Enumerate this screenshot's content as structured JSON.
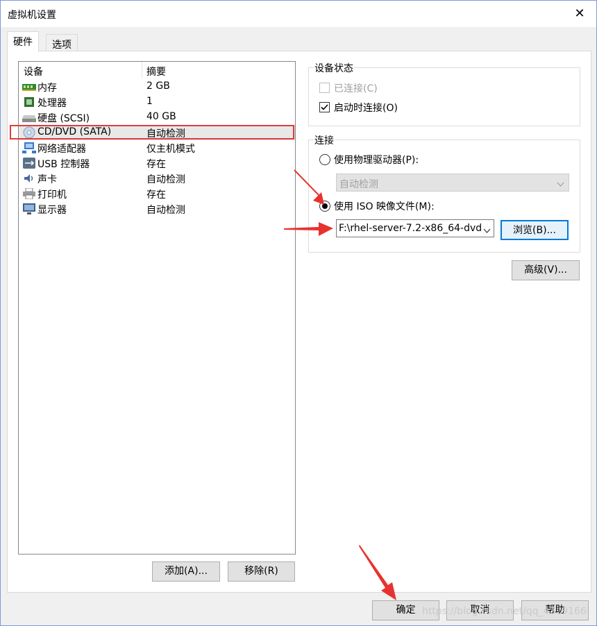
{
  "window": {
    "title": "虚拟机设置",
    "close_glyph": "✕"
  },
  "tabs": [
    {
      "label": "硬件",
      "active": true
    },
    {
      "label": "选项",
      "active": false
    }
  ],
  "device_list": {
    "columns": [
      "设备",
      "摘要"
    ],
    "rows": [
      {
        "name": "内存",
        "summary": "2 GB",
        "icon": "memory-icon"
      },
      {
        "name": "处理器",
        "summary": "1",
        "icon": "processor-icon"
      },
      {
        "name": "硬盘 (SCSI)",
        "summary": "40 GB",
        "icon": "hard-disk-icon"
      },
      {
        "name": "CD/DVD (SATA)",
        "summary": "自动检测",
        "icon": "cd-dvd-icon",
        "selected": true
      },
      {
        "name": "网络适配器",
        "summary": "仅主机模式",
        "icon": "network-adapter-icon"
      },
      {
        "name": "USB 控制器",
        "summary": "存在",
        "icon": "usb-icon"
      },
      {
        "name": "声卡",
        "summary": "自动检测",
        "icon": "sound-card-icon"
      },
      {
        "name": "打印机",
        "summary": "存在",
        "icon": "printer-icon"
      },
      {
        "name": "显示器",
        "summary": "自动检测",
        "icon": "display-icon"
      }
    ]
  },
  "list_buttons": {
    "add": "添加(A)...",
    "remove": "移除(R)"
  },
  "device_status": {
    "title": "设备状态",
    "connected": {
      "label": "已连接(C)",
      "checked": false,
      "disabled": true
    },
    "connect_at_power_on": {
      "label": "启动时连接(O)",
      "checked": true
    }
  },
  "connection": {
    "title": "连接",
    "physical_drive": {
      "label": "使用物理驱动器(P):",
      "selected": false,
      "dropdown_value": "自动检测"
    },
    "iso_image": {
      "label": "使用 ISO 映像文件(M):",
      "selected": true,
      "path": "F:\\rhel-server-7.2-x86_64-dvd.",
      "browse_label": "浏览(B)..."
    }
  },
  "advanced_button": "高级(V)...",
  "footer": {
    "ok": "确定",
    "cancel": "取消",
    "help": "帮助"
  },
  "watermark": "https://blog.csdn.net/qq_43..9166",
  "colors": {
    "highlight": "#e03b3b",
    "arrow": "#e8322f"
  }
}
